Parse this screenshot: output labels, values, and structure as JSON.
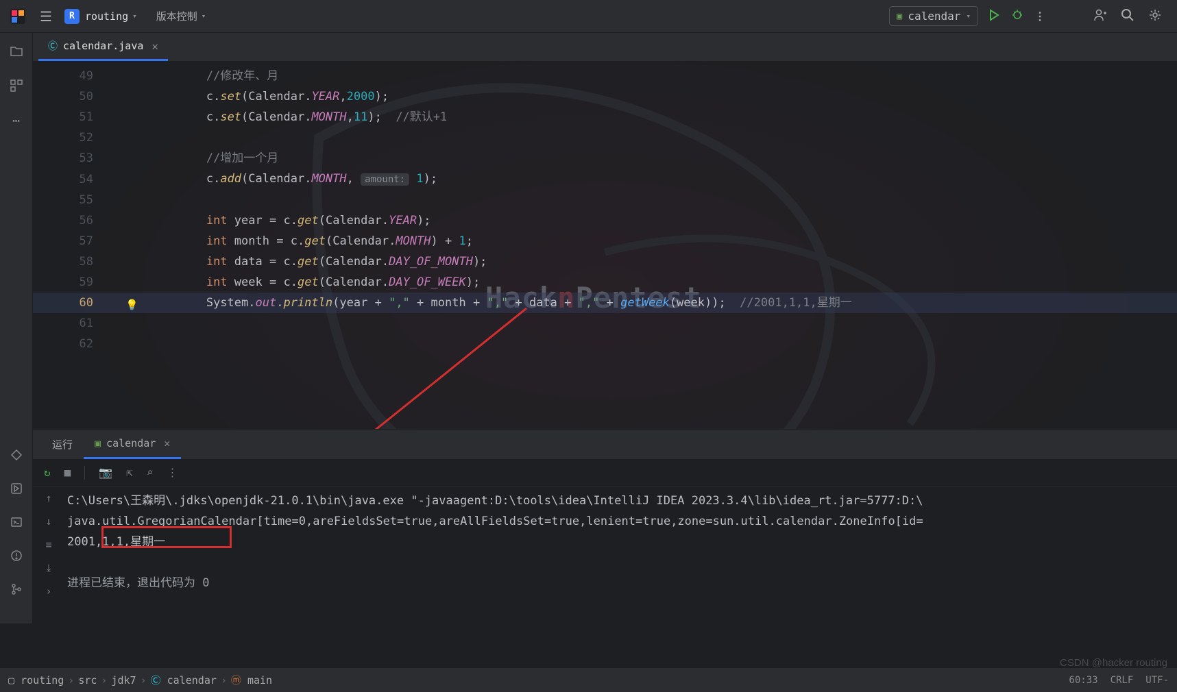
{
  "titlebar": {
    "project_badge": "R",
    "project_name": "routing",
    "vc_label": "版本控制",
    "run_config": "calendar"
  },
  "file_tab": {
    "name": "calendar.java"
  },
  "code": {
    "lines": [
      {
        "n": "49",
        "cls": ""
      },
      {
        "n": "50",
        "cls": ""
      },
      {
        "n": "51",
        "cls": ""
      },
      {
        "n": "52",
        "cls": ""
      },
      {
        "n": "53",
        "cls": ""
      },
      {
        "n": "54",
        "cls": ""
      },
      {
        "n": "55",
        "cls": ""
      },
      {
        "n": "56",
        "cls": ""
      },
      {
        "n": "57",
        "cls": ""
      },
      {
        "n": "58",
        "cls": ""
      },
      {
        "n": "59",
        "cls": ""
      },
      {
        "n": "60",
        "cls": "cur"
      },
      {
        "n": "61",
        "cls": ""
      },
      {
        "n": "62",
        "cls": ""
      }
    ],
    "comment_49": "//修改年、月",
    "comment_51b": "//默认+1",
    "comment_53": "//增加一个月",
    "hint_amount": "amount:",
    "comment_60": "//2001,1,1,星期一",
    "t50_set": "set",
    "t50_cal": "Calendar",
    "t50_year": "YEAR",
    "t50_v": "2000",
    "t51_set": "set",
    "t51_cal": "Calendar",
    "t51_month": "MONTH",
    "t51_v": "11",
    "t54_add": "add",
    "t54_cal": "Calendar",
    "t54_month": "MONTH",
    "t54_v": "1",
    "t56_int": "int",
    "t56_var": "year",
    "t56_get": "get",
    "t56_cal": "Calendar",
    "t56_f": "YEAR",
    "t57_int": "int",
    "t57_var": "month",
    "t57_get": "get",
    "t57_cal": "Calendar",
    "t57_f": "MONTH",
    "t57_plus": " + ",
    "t57_one": "1",
    "t58_int": "int",
    "t58_var": "data",
    "t58_get": "get",
    "t58_cal": "Calendar",
    "t58_f": "DAY_OF_MONTH",
    "t59_int": "int",
    "t59_var": "week",
    "t59_get": "get",
    "t59_cal": "Calendar",
    "t59_f": "DAY_OF_WEEK",
    "t60_sys": "System",
    "t60_out": "out",
    "t60_pl": "println",
    "t60_y": "year",
    "t60_c": "\",\"",
    "t60_m": "month",
    "t60_d": "data",
    "t60_gw": "getWeek",
    "t60_w": "week"
  },
  "watermark_brand_a": "Hack",
  "watermark_brand_b": "n",
  "watermark_brand_c": "Pentest",
  "console_tabs": {
    "run": "运行",
    "active": "calendar"
  },
  "console": {
    "line1": "C:\\Users\\王森明\\.jdks\\openjdk-21.0.1\\bin\\java.exe \"-javaagent:D:\\tools\\idea\\IntelliJ IDEA 2023.3.4\\lib\\idea_rt.jar=5777:D:\\",
    "line2": "java.util.GregorianCalendar[time=0,areFieldsSet=true,areAllFieldsSet=true,lenient=true,zone=sun.util.calendar.ZoneInfo[id=",
    "line3": "2001,1,1,星期一",
    "line4": "进程已结束，退出代码为 0"
  },
  "breadcrumb": {
    "p1": "routing",
    "p2": "src",
    "p3": "jdk7",
    "p4": "calendar",
    "p5": "main"
  },
  "status": {
    "pos": "60:33",
    "sep": "CRLF",
    "enc": "UTF-"
  },
  "corner_wm": "CSDN @hacker routing"
}
